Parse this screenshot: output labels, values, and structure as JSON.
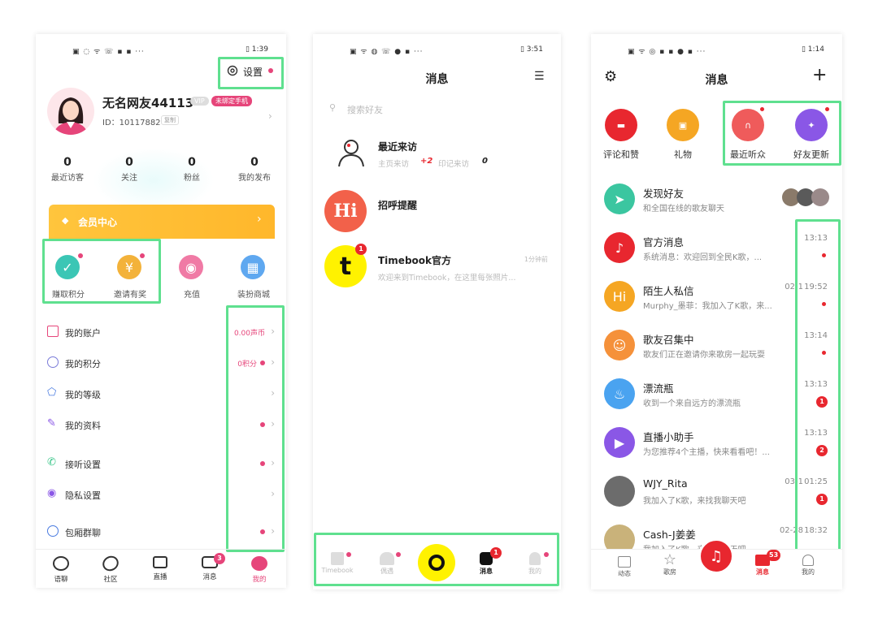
{
  "colors": {
    "highlight": "#5fe08f",
    "pink": "#e6457a",
    "red": "#e8272f",
    "gold": "#ffc53d",
    "yellow": "#fff200"
  },
  "phone1": {
    "status": {
      "left": "▣ ◌ ᯤ ☏ ▪ ▪ ···",
      "right": "▯ 1:39"
    },
    "settings_label": "设置",
    "username": "无名网友44113",
    "vip_badge": "VIP",
    "pink_badge": "未绑定手机",
    "user_id": "ID：10117882",
    "copy_label": "复制",
    "stats": [
      {
        "value": "0",
        "label": "最近访客"
      },
      {
        "value": "0",
        "label": "关注"
      },
      {
        "value": "0",
        "label": "粉丝"
      },
      {
        "value": "0",
        "label": "我的发布"
      }
    ],
    "vip_center": "会员中心",
    "actions": [
      {
        "label": "赚取积分",
        "color": "#3bc6b5"
      },
      {
        "label": "邀请有奖",
        "color": "#f3b23a"
      },
      {
        "label": "充值",
        "color": "#f07aa5"
      },
      {
        "label": "装扮商城",
        "color": "#5fa8f0"
      }
    ],
    "menu": [
      {
        "label": "我的账户",
        "value": "0.00声币"
      },
      {
        "label": "我的积分",
        "value": "0积分"
      },
      {
        "label": "我的等级",
        "value": ""
      },
      {
        "label": "我的资料",
        "value": ""
      },
      {
        "label": "接听设置",
        "value": ""
      },
      {
        "label": "隐私设置",
        "value": ""
      },
      {
        "label": "包厢群聊",
        "value": ""
      }
    ],
    "tabs": [
      {
        "label": "语聊",
        "icon": "waveform-icon"
      },
      {
        "label": "社区",
        "icon": "planet-icon"
      },
      {
        "label": "直播",
        "icon": "video-icon"
      },
      {
        "label": "消息",
        "icon": "chat-icon",
        "badge": "3"
      },
      {
        "label": "我的",
        "icon": "profile-icon"
      }
    ]
  },
  "phone2": {
    "status": {
      "left": "▣ ᯤ ◍ ☏ ● ▪ ···",
      "right": "▯ 3:51"
    },
    "title": "消息",
    "search_placeholder": "搜索好友",
    "visitors": {
      "title": "最近来访",
      "line1": "主页来访",
      "line1_value": "+2",
      "line2": "印记来访",
      "line2_value": "0"
    },
    "greeting": {
      "title": "招呼提醒",
      "avatar_text": "Hi"
    },
    "official": {
      "title": "Timebook官方",
      "time": "1分钟前",
      "preview": "欢迎来到Timebook，在这里每张照片...",
      "badge": "1",
      "avatar_text": "t"
    },
    "tabs": [
      {
        "label": "Timebook"
      },
      {
        "label": "偶遇"
      },
      {
        "label": ""
      },
      {
        "label": "消息",
        "badge": "1"
      },
      {
        "label": "我的"
      }
    ]
  },
  "phone3": {
    "status": {
      "left": "▣ ᯤ ◎ ▪ ▪ ● ▪ ···",
      "right": "▯ 1:14"
    },
    "title": "消息",
    "quick": [
      {
        "label": "评论和赞",
        "color": "#e8272f",
        "icon": "comment-icon"
      },
      {
        "label": "礼物",
        "color": "#f5a623",
        "icon": "gift-icon"
      },
      {
        "label": "最近听众",
        "color": "#ef5b5b",
        "icon": "headphones-icon"
      },
      {
        "label": "好友更新",
        "color": "#8a57e6",
        "icon": "user-plus-icon"
      }
    ],
    "discover": {
      "name": "发现好友",
      "preview": "和全国在线的歌友聊天"
    },
    "chats": [
      {
        "name": "官方消息",
        "preview": "系统消息：欢迎回到全民K歌，...",
        "date": "",
        "time": "13:13",
        "badge": "",
        "color": "#e8272f"
      },
      {
        "name": "陌生人私信",
        "preview": "Murphy_墨菲：我加入了K歌，来...",
        "date": "02-1",
        "time": "19:52",
        "badge": "",
        "color": "#f5a623"
      },
      {
        "name": "歌友召集中",
        "preview": "歌友们正在邀请你来歌房一起玩耍",
        "date": "",
        "time": "13:14",
        "badge": "",
        "color": "#f5913a"
      },
      {
        "name": "漂流瓶",
        "preview": "收到一个来自远方的漂流瓶",
        "date": "",
        "time": "13:13",
        "badge": "1",
        "color": "#4aa3f0"
      },
      {
        "name": "直播小助手",
        "preview": "为您推荐4个主播，快来看看吧！...",
        "date": "",
        "time": "13:13",
        "badge": "2",
        "color": "#8a57e6"
      },
      {
        "name": "WJY_Rita",
        "preview": "我加入了K歌，来找我聊天吧",
        "date": "03-1",
        "time": "01:25",
        "badge": "1",
        "color": "#6c6c6c"
      },
      {
        "name": "Cash-J姜姜",
        "preview": "我加入了K歌，来找我聊天吧",
        "date": "02-28",
        "time": "18:32",
        "badge": "",
        "color": "#c9b27a"
      }
    ],
    "tabs": [
      {
        "label": "动态",
        "icon": "feed-icon"
      },
      {
        "label": "歌房",
        "icon": "star-icon"
      },
      {
        "label": "",
        "icon": "sing-icon"
      },
      {
        "label": "消息",
        "icon": "mail-icon",
        "badge": "53"
      },
      {
        "label": "我的",
        "icon": "profile-icon"
      }
    ]
  }
}
